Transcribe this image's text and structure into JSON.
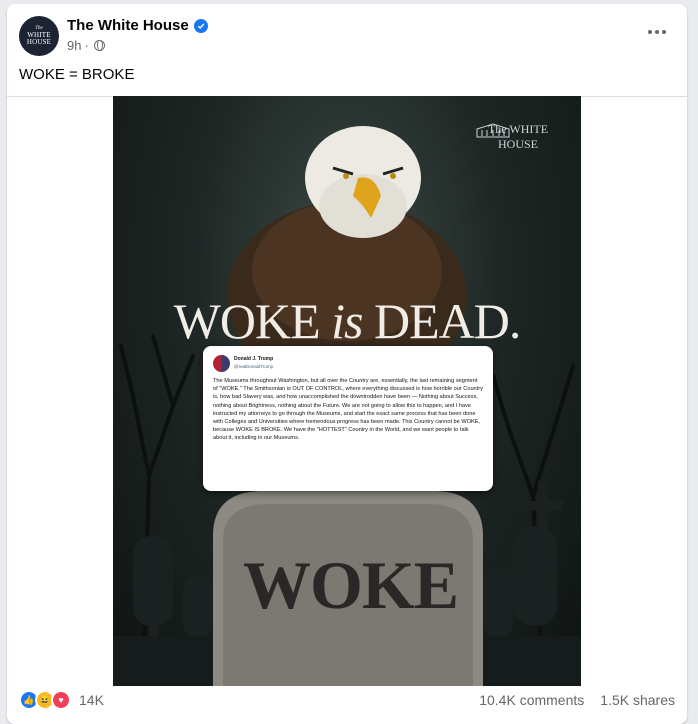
{
  "post": {
    "page_name": "The White House",
    "time": "9h",
    "separator": "·",
    "text": "WOKE = BROKE"
  },
  "avatar": {
    "line1": "The",
    "line2": "WHITE",
    "line3": "HOUSE"
  },
  "icons": {
    "verified": "verified-badge-icon",
    "privacy": "globe-icon",
    "more": "more-options-icon"
  },
  "image": {
    "watermark": "The WHITE HOUSE",
    "headline_pre": "WOKE ",
    "headline_em": "is",
    "headline_post": " DEAD.",
    "tombstone_word": "WOKE",
    "tweet": {
      "name": "Donald J. Trump",
      "handle": "@realDonaldTrump",
      "text": "The Museums throughout Washington, but all over the Country are, essentially, the last remaining segment of \"WOKE.\" The Smithsonian is OUT OF CONTROL, where everything discussed is how horrible our Country is, how bad Slavery was, and how unaccomplished the downtrodden have been — Nothing about Success, nothing about Brightness, nothing about the Future. We are not going to allow this to happen, and I have instructed my attorneys to go through the Museums, and start the exact same process that has been done with Colleges and Universities where tremendous progress has been made. This Country cannot be WOKE, because WOKE IS BROKE. We have the \"HOTTEST\" Country in the World, and we want people to talk about it, including in our Museums."
    }
  },
  "engagement": {
    "reaction_count": "14K",
    "comments": "10.4K comments",
    "shares": "1.5K shares"
  },
  "colors": {
    "brand_blue": "#1877f2",
    "secondary_text": "#65676b"
  }
}
